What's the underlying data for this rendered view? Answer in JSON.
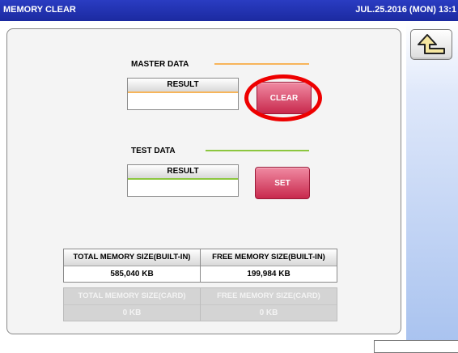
{
  "titlebar": {
    "title": "MEMORY CLEAR",
    "datetime": "JUL.25.2016 (MON) 13:1"
  },
  "master": {
    "label": "MASTER DATA",
    "result_header": "RESULT",
    "result_value": "",
    "button_label": "CLEAR",
    "line_color": "#f7b55a"
  },
  "test": {
    "label": "TEST DATA",
    "result_header": "RESULT",
    "result_value": "",
    "button_label": "SET",
    "line_color": "#8cc63f"
  },
  "memory": {
    "total_builtin_label": "TOTAL MEMORY SIZE(BUILT-IN)",
    "total_builtin_value": "585,040 KB",
    "free_builtin_label": "FREE MEMORY SIZE(BUILT-IN)",
    "free_builtin_value": "199,984 KB",
    "total_card_label": "TOTAL MEMORY SIZE(CARD)",
    "total_card_value": "0 KB",
    "free_card_label": "FREE MEMORY SIZE(CARD)",
    "free_card_value": "0 KB"
  },
  "icons": {
    "back": "return-arrow-icon"
  },
  "colors": {
    "titlebar": "#1f2fa8",
    "button_red": "#d23a5c",
    "highlight_circle": "#ee0000"
  }
}
